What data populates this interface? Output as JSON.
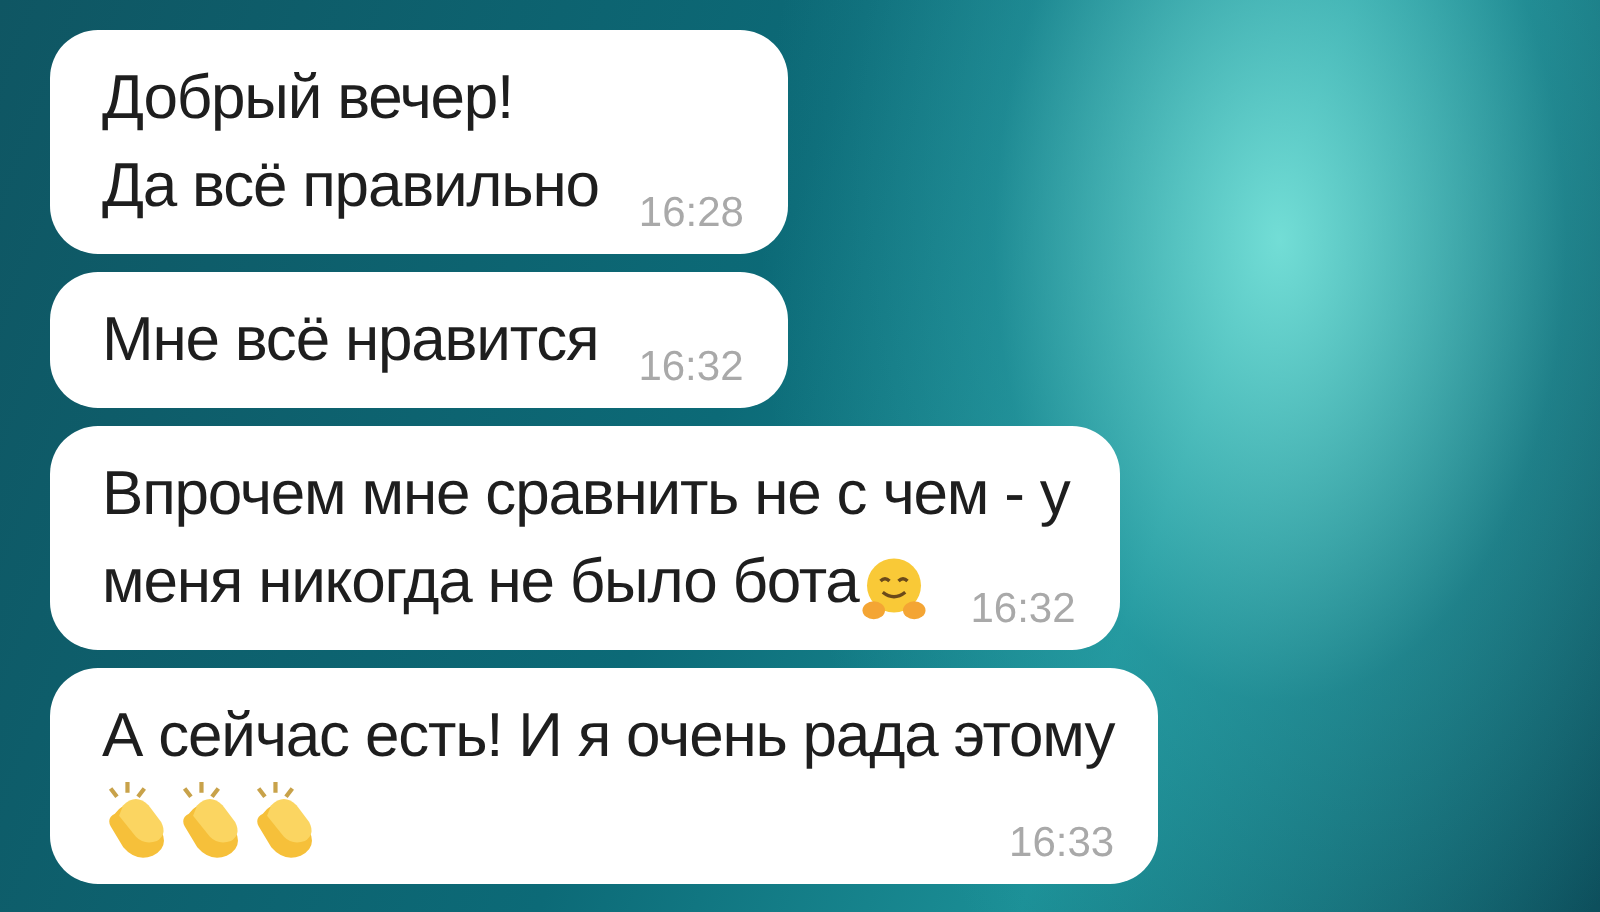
{
  "messages": [
    {
      "kind": "inline",
      "lines": [
        "Добрый вечер!",
        "Да всё правильно"
      ],
      "time": "16:28"
    },
    {
      "kind": "inline",
      "lines": [
        "Мне всё нравится"
      ],
      "time": "16:32"
    },
    {
      "kind": "inline",
      "lines": [
        "Впрочем мне сравнить не с чем - у",
        "меня никогда не было бота"
      ],
      "icons": [
        {
          "kind": "hugging-face"
        }
      ],
      "time": "16:32"
    },
    {
      "kind": "stacked",
      "lines": [
        "А сейчас есть! И я очень рада этому"
      ],
      "icons": [
        {
          "kind": "clapping-hands"
        },
        {
          "kind": "clapping-hands"
        },
        {
          "kind": "clapping-hands"
        }
      ],
      "time": "16:33"
    }
  ]
}
